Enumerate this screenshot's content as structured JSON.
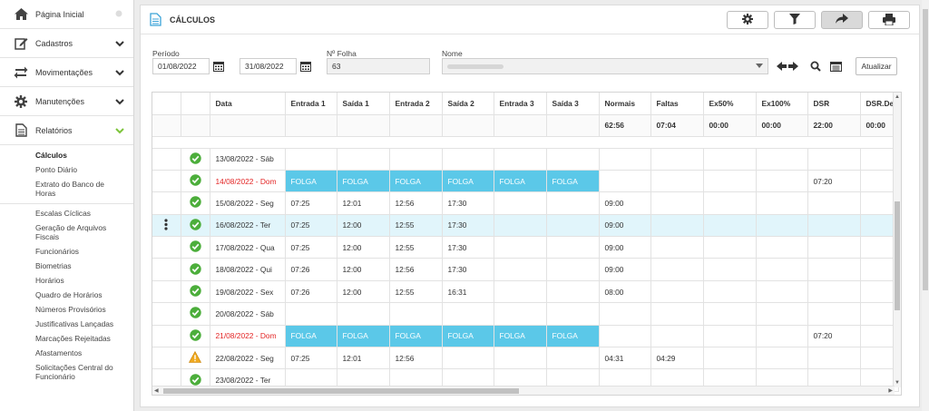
{
  "sidebar": {
    "items": [
      {
        "label": "Página Inicial"
      },
      {
        "label": "Cadastros"
      },
      {
        "label": "Movimentações"
      },
      {
        "label": "Manutenções"
      },
      {
        "label": "Relatórios"
      }
    ],
    "sub_items": [
      "Cálculos",
      "Ponto Diário",
      "Extrato do Banco de Horas",
      "Escalas Cíclicas",
      "Geração de Arquivos Fiscais",
      "Funcionários",
      "Biometrias",
      "Horários",
      "Quadro de Horários",
      "Números Provisórios",
      "Justificativas Lançadas",
      "Marcações Rejeitadas",
      "Afastamentos",
      "Solicitações Central do Funcionário"
    ]
  },
  "header": {
    "title": "CÁLCULOS"
  },
  "filters": {
    "periodo_label": "Período",
    "start_date": "01/08/2022",
    "end_date": "31/08/2022",
    "folha_label": "Nº Folha",
    "folha_value": "63",
    "nome_label": "Nome",
    "update_label": "Atualizar"
  },
  "table": {
    "columns": [
      "Data",
      "Entrada 1",
      "Saída 1",
      "Entrada 2",
      "Saída 2",
      "Entrada 3",
      "Saída 3",
      "Normais",
      "Faltas",
      "Ex50%",
      "Ex100%",
      "DSR",
      "DSR.De"
    ],
    "totals": [
      "",
      "",
      "",
      "",
      "",
      "",
      "",
      "62:56",
      "07:04",
      "00:00",
      "00:00",
      "22:00",
      "00:00"
    ],
    "rows": [
      {
        "status": "ok",
        "cells": [
          "13/08/2022 - Sáb",
          "",
          "",
          "",
          "",
          "",
          "",
          "",
          "",
          "",
          "",
          "",
          ""
        ]
      },
      {
        "status": "ok",
        "folga": true,
        "red": true,
        "cells": [
          "14/08/2022 - Dom",
          "FOLGA",
          "FOLGA",
          "FOLGA",
          "FOLGA",
          "FOLGA",
          "FOLGA",
          "",
          "",
          "",
          "",
          "07:20",
          ""
        ]
      },
      {
        "status": "ok",
        "cells": [
          "15/08/2022 - Seg",
          "07:25",
          "12:01",
          "12:56",
          "17:30",
          "",
          "",
          "09:00",
          "",
          "",
          "",
          "",
          ""
        ]
      },
      {
        "status": "ok",
        "selected": true,
        "cells": [
          "16/08/2022 - Ter",
          "07:25",
          "12:00",
          "12:55",
          "17:30",
          "",
          "",
          "09:00",
          "",
          "",
          "",
          "",
          ""
        ]
      },
      {
        "status": "ok",
        "cells": [
          "17/08/2022 - Qua",
          "07:25",
          "12:00",
          "12:55",
          "17:30",
          "",
          "",
          "09:00",
          "",
          "",
          "",
          "",
          ""
        ]
      },
      {
        "status": "ok",
        "cells": [
          "18/08/2022 - Qui",
          "07:26",
          "12:00",
          "12:56",
          "17:30",
          "",
          "",
          "09:00",
          "",
          "",
          "",
          "",
          ""
        ]
      },
      {
        "status": "ok",
        "cells": [
          "19/08/2022 - Sex",
          "07:26",
          "12:00",
          "12:55",
          "16:31",
          "",
          "",
          "08:00",
          "",
          "",
          "",
          "",
          ""
        ]
      },
      {
        "status": "ok",
        "cells": [
          "20/08/2022 - Sáb",
          "",
          "",
          "",
          "",
          "",
          "",
          "",
          "",
          "",
          "",
          "",
          ""
        ]
      },
      {
        "status": "ok",
        "folga": true,
        "red": true,
        "cells": [
          "21/08/2022 - Dom",
          "FOLGA",
          "FOLGA",
          "FOLGA",
          "FOLGA",
          "FOLGA",
          "FOLGA",
          "",
          "",
          "",
          "",
          "07:20",
          ""
        ]
      },
      {
        "status": "warning",
        "cells": [
          "22/08/2022 - Seg",
          "07:25",
          "12:01",
          "12:56",
          "",
          "",
          "",
          "04:31",
          "04:29",
          "",
          "",
          "",
          ""
        ]
      },
      {
        "status": "ok",
        "cells": [
          "23/08/2022 - Ter",
          "",
          "",
          "",
          "",
          "",
          "",
          "",
          "",
          "",
          "",
          "",
          ""
        ]
      }
    ]
  },
  "colors": {
    "folga": "#5bc8e8",
    "selected_row": "#e1f5fb",
    "status_ok": "#4cae3b",
    "status_warning": "#f0a91e",
    "sunday": "#e32626"
  }
}
